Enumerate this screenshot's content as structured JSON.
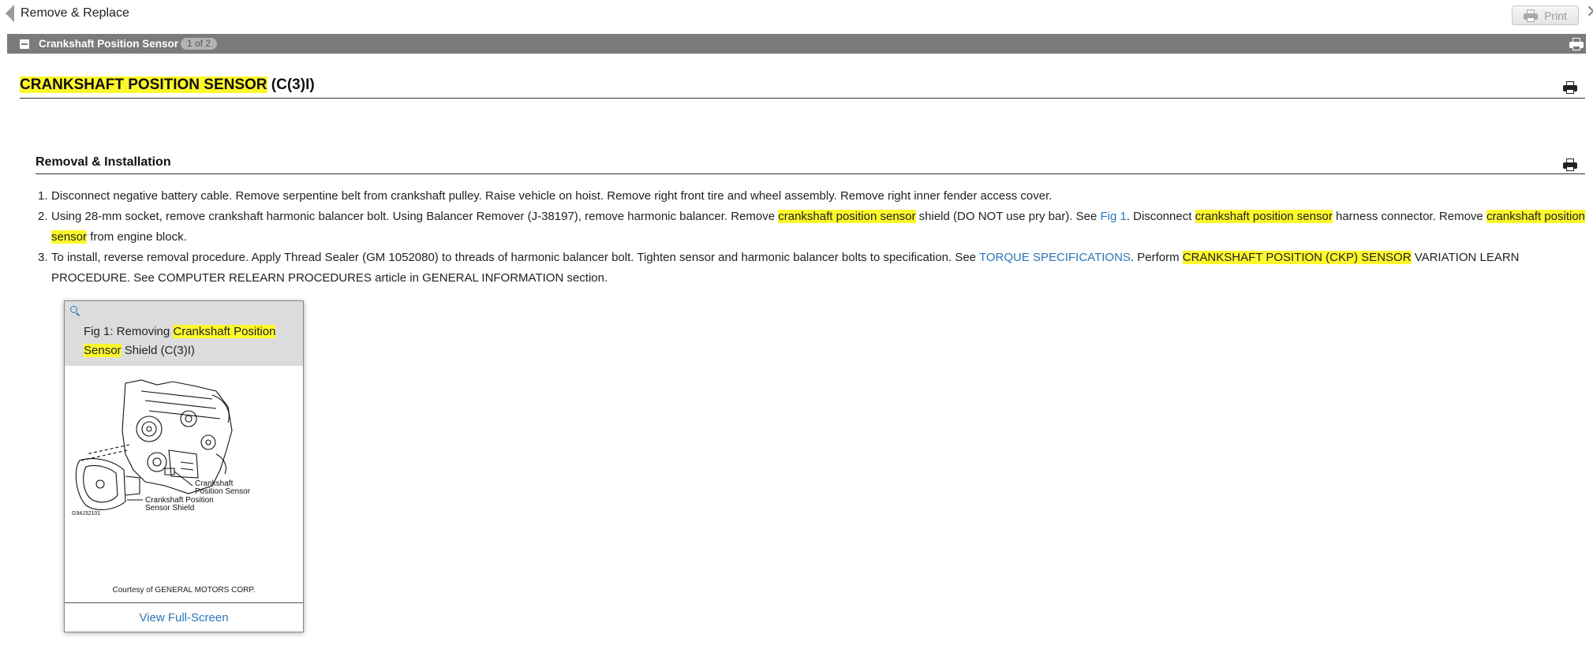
{
  "topbar": {
    "title": "Remove & Replace",
    "print_label": "Print"
  },
  "section": {
    "title": "Crankshaft Position Sensor",
    "count": "1 of 2"
  },
  "document": {
    "title_highlight": "CRANKSHAFT POSITION SENSOR",
    "title_suffix": " (C(3)I)",
    "subheading": "Removal & Installation",
    "steps": [
      {
        "num": "1.",
        "text": "Disconnect negative battery cable. Remove serpentine belt from crankshaft pulley. Raise vehicle on hoist. Remove right front tire and wheel assembly. Remove right inner fender access cover."
      },
      {
        "num": "2.",
        "t1": "Using 28-mm socket, remove crankshaft harmonic balancer bolt. Using Balancer Remover (J-38197), remove harmonic balancer. Remove ",
        "h1": "crankshaft position sensor",
        "t2": " shield (DO NOT use pry bar). See ",
        "link": "Fig 1",
        "t3": ". Disconnect ",
        "h2": "crankshaft position sensor",
        "t4": " harness connector. Remove ",
        "h3": "crankshaft position sensor",
        "t5": " from engine block."
      },
      {
        "num": "3.",
        "t1": "To install, reverse removal procedure. Apply Thread Sealer (GM 1052080) to threads of harmonic balancer bolt. Tighten sensor and harmonic balancer bolts to specification. See ",
        "link": "TORQUE SPECIFICATIONS",
        "t2": ". Perform ",
        "h1": "CRANKSHAFT POSITION (CKP) SENSOR",
        "t3": " VARIATION LEARN PROCEDURE. See COMPUTER RELEARN PROCEDURES article in GENERAL INFORMATION section."
      }
    ]
  },
  "figure": {
    "caption_prefix": "Fig 1: Removing ",
    "caption_highlight": "Crankshaft Position Sensor",
    "caption_suffix": " Shield (C(3)I)",
    "image_labels": {
      "sensor": [
        "Crankshaft",
        "Position Sensor"
      ],
      "shield": [
        "Crankshaft Position",
        "Sensor Shield"
      ],
      "code": "G94J32101"
    },
    "credit": "Courtesy of GENERAL MOTORS CORP.",
    "view_label": "View Full-Screen"
  },
  "colors": {
    "highlight": "#fdf82c",
    "link": "#2a76b8",
    "section_bar": "#7b7b7b"
  }
}
